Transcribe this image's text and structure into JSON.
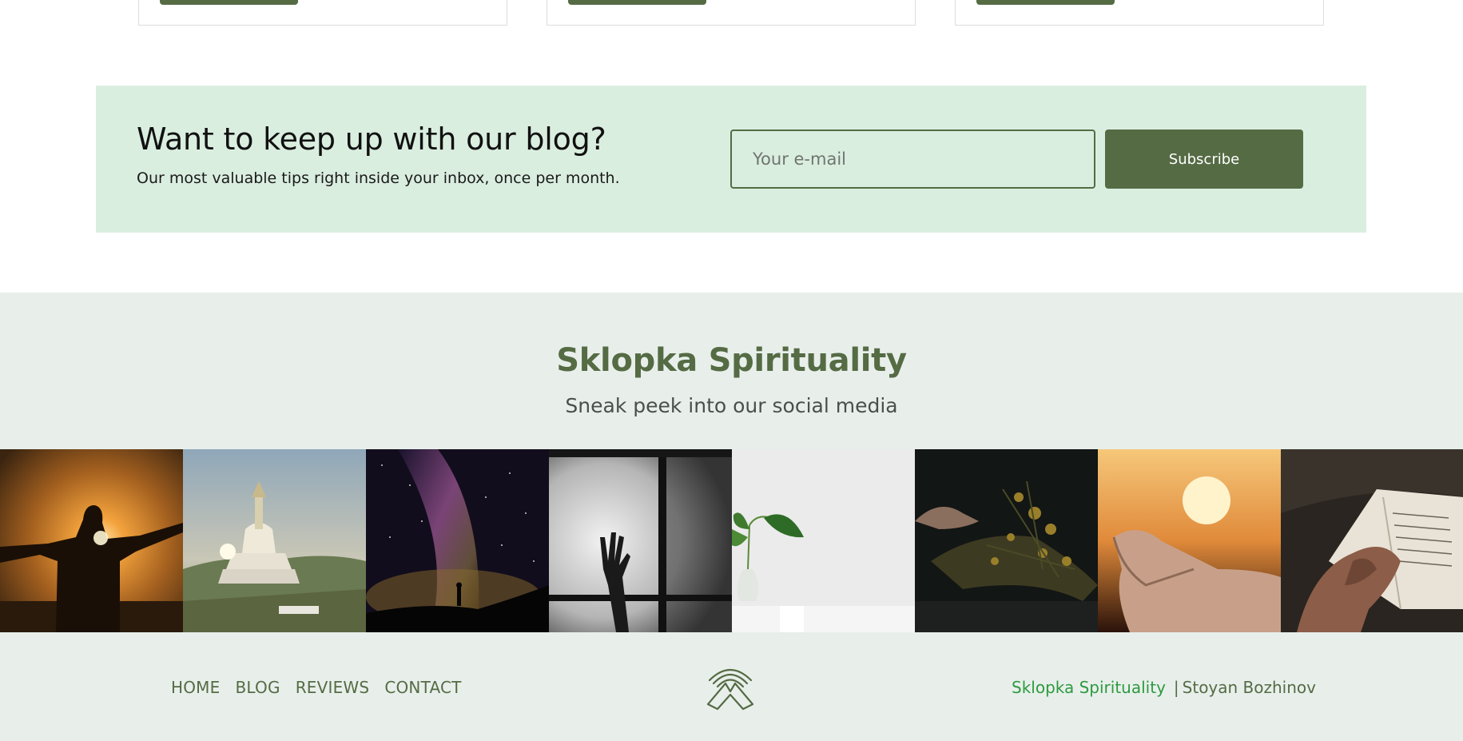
{
  "newsletter": {
    "title": "Want to keep up with our blog?",
    "subtitle": "Our most valuable tips right inside your inbox, once per month.",
    "email_placeholder": "Your e-mail",
    "subscribe_label": "Subscribe"
  },
  "social": {
    "brand": "Sklopka Spirituality",
    "tagline": "Sneak peek into our social media",
    "photos": [
      "sunset-open-arms-photo",
      "stupa-sunrise-photo",
      "milky-way-silhouette-photo",
      "hand-behind-glass-photo",
      "plant-in-vase-photo",
      "dried-flowers-hand-photo",
      "hand-sunset-photo",
      "hands-on-bible-photo"
    ]
  },
  "footer": {
    "nav": [
      "HOME",
      "BLOG",
      "REVIEWS",
      "CONTACT"
    ],
    "logo_icon": "praying-hands-icon",
    "credit_brand": "Sklopka Spirituality",
    "credit_separator": "|",
    "credit_author": "Stoyan Bozhinov"
  },
  "colors": {
    "accent": "#556b44",
    "newsletter_bg": "#daeee0",
    "footer_bg": "#e8efeb",
    "credit_link": "#2e9a3f"
  }
}
